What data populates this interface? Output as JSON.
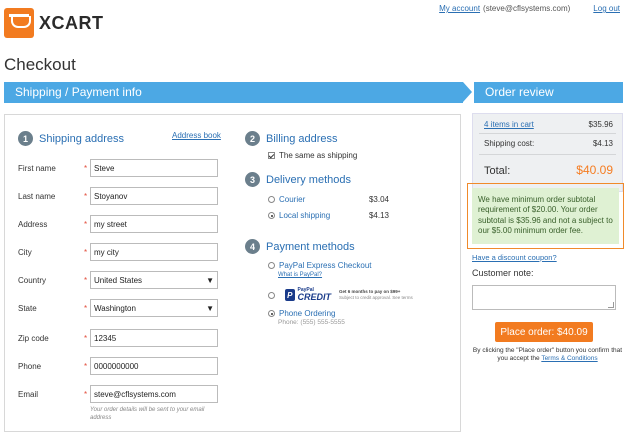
{
  "brand": {
    "name": "XCART"
  },
  "header": {
    "my_account": "My account",
    "email": "(steve@cflsystems.com)",
    "logout": "Log out"
  },
  "page_title": "Checkout",
  "steps": {
    "left": "Shipping / Payment info",
    "right": "Order review"
  },
  "shipping_address": {
    "number": "1",
    "title": "Shipping address",
    "address_book": "Address book",
    "required_mark": "*",
    "fields": {
      "first_name": {
        "label": "First name",
        "value": "Steve"
      },
      "last_name": {
        "label": "Last name",
        "value": "Stoyanov"
      },
      "address": {
        "label": "Address",
        "value": "my street"
      },
      "city": {
        "label": "City",
        "value": "my city"
      },
      "country": {
        "label": "Country",
        "value": "United States"
      },
      "state": {
        "label": "State",
        "value": "Washington"
      },
      "zip": {
        "label": "Zip code",
        "value": "12345"
      },
      "phone": {
        "label": "Phone",
        "value": "0000000000"
      },
      "email": {
        "label": "Email",
        "value": "steve@cflsystems.com"
      }
    },
    "email_hint": "Your order details will be sent to your email address"
  },
  "billing_address": {
    "number": "2",
    "title": "Billing address",
    "same_as_shipping": "The same as shipping",
    "same_checked": true
  },
  "delivery_methods": {
    "number": "3",
    "title": "Delivery methods",
    "options": [
      {
        "name": "Courier",
        "price": "$3.04",
        "selected": false
      },
      {
        "name": "Local shipping",
        "price": "$4.13",
        "selected": true
      }
    ]
  },
  "payment_methods": {
    "number": "4",
    "title": "Payment methods",
    "paypal_express": {
      "name": "PayPal Express Checkout",
      "link": "What is PayPal?"
    },
    "paypal_credit": {
      "logo_top": "PayPal",
      "logo_bottom": "CREDIT",
      "promo_line1": "Get 6 months to pay on $99+",
      "promo_line2": "Subject to credit approval. See terms"
    },
    "phone_ordering": {
      "name": "Phone Ordering",
      "phone": "Phone: (555) 555-5555",
      "selected": true
    }
  },
  "order_review": {
    "items_link": "4 items in cart",
    "items_value": "$35.96",
    "shipping_label": "Shipping cost:",
    "shipping_value": "$4.13",
    "total_label": "Total:",
    "total_value": "$40.09"
  },
  "notice": "We have minimum order subtotal requirement of $20.00. Your order subtotal is $35.96 and not a subject to our $5.00 minimum order fee.",
  "discount_link": "Have a discount coupon?",
  "customer_note_label": "Customer note:",
  "place_order_button": "Place order: $40.09",
  "terms": {
    "text": "By clicking the \"Place order\" button you confirm that you accept the",
    "link": "Terms & Conditions"
  },
  "colors": {
    "accent": "#4ca8e4",
    "brand_orange": "#f27b20",
    "notice_bg": "#dff1d3"
  }
}
